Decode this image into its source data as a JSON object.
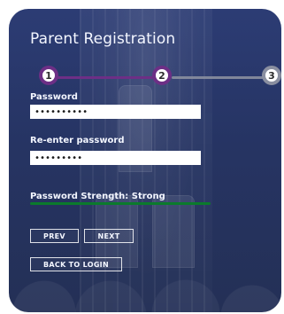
{
  "form": {
    "title": "Parent Registration",
    "steps": [
      "1",
      "2",
      "3"
    ],
    "fields": {
      "password": {
        "label": "Password",
        "value": "••••••••••"
      },
      "reenter_password": {
        "label": "Re-enter password",
        "value": "•••••••••"
      }
    },
    "strength": {
      "text": "Password Strength: Strong",
      "color": "#0b7a2c"
    },
    "buttons": {
      "prev": "PREV",
      "next": "NEXT",
      "back_to_login": "BACK TO LOGIN"
    }
  },
  "colors": {
    "step_active": "#6d2f86",
    "step_inactive": "#8a8fa0",
    "text": "#f3f6ff"
  }
}
